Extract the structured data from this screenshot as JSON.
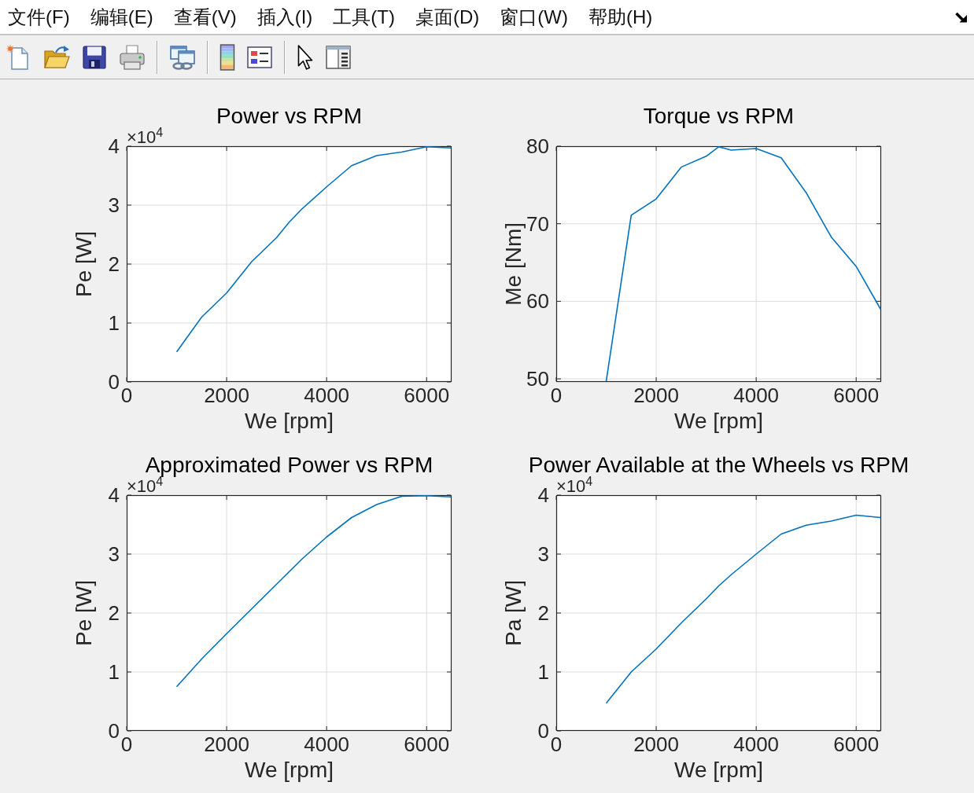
{
  "menu": [
    "文件(F)",
    "编辑(E)",
    "查看(V)",
    "插入(I)",
    "工具(T)",
    "桌面(D)",
    "窗口(W)",
    "帮助(H)"
  ],
  "plots": [
    {
      "exponent": "×10$^{4}$",
      "chart_data": {
        "type": "line",
        "title": "Power vs RPM",
        "xlabel": "We [rpm]",
        "ylabel": "Pe [W]",
        "x": [
          1000,
          1500,
          2000,
          2500,
          3000,
          3250,
          3500,
          4000,
          4500,
          5000,
          5500,
          6000,
          6500
        ],
        "series": [
          {
            "color": "#0072bd",
            "values": [
              0.51,
              1.1,
              1.51,
              2.04,
              2.45,
              2.71,
              2.93,
              3.31,
              3.67,
              3.84,
              3.9,
              4.0,
              3.97
            ]
          }
        ],
        "xlim": [
          0,
          6500
        ],
        "ylim": [
          0,
          4
        ],
        "xticks": [
          0,
          2000,
          4000,
          6000
        ],
        "yticks": [
          0,
          1,
          2,
          3,
          4
        ],
        "grid": true
      }
    },
    {
      "chart_data": {
        "type": "line",
        "title": "Torque vs RPM",
        "xlabel": "We [rpm]",
        "ylabel": "Me [Nm]",
        "x": [
          1000,
          1500,
          2000,
          2500,
          3000,
          3250,
          3500,
          4000,
          4500,
          5000,
          5500,
          6000,
          6500
        ],
        "series": [
          {
            "color": "#0072bd",
            "values": [
              49.6,
              71.1,
              73.2,
              77.3,
              78.7,
              80.0,
              79.5,
              79.7,
              78.5,
              74.0,
              68.3,
              64.5,
              59.0
            ]
          }
        ],
        "xlim": [
          0,
          6500
        ],
        "ylim": [
          49.6,
          80
        ],
        "xticks": [
          0,
          2000,
          4000,
          6000
        ],
        "yticks": [
          50,
          60,
          70,
          80
        ],
        "grid": true
      }
    },
    {
      "exponent": "×10$^{4}$",
      "chart_data": {
        "type": "line",
        "title": "Approximated Power vs RPM",
        "xlabel": "We [rpm]",
        "ylabel": "Pe [W]",
        "x": [
          1000,
          1500,
          2000,
          2500,
          3000,
          3500,
          4000,
          4500,
          5000,
          5500,
          6000,
          6500
        ],
        "series": [
          {
            "color": "#0072bd",
            "values": [
              0.75,
              1.22,
              1.65,
              2.07,
              2.49,
              2.91,
              3.29,
              3.62,
              3.84,
              3.98,
              4.0,
              3.97
            ]
          }
        ],
        "xlim": [
          0,
          6500
        ],
        "ylim": [
          0,
          4
        ],
        "xticks": [
          0,
          2000,
          4000,
          6000
        ],
        "yticks": [
          0,
          1,
          2,
          3,
          4
        ],
        "grid": true
      }
    },
    {
      "exponent": "×10$^{4}$",
      "chart_data": {
        "type": "line",
        "title": "Power Available at the Wheels vs RPM",
        "xlabel": "We [rpm]",
        "ylabel": "Pa [W]",
        "x": [
          1000,
          1500,
          2000,
          2500,
          3000,
          3250,
          3500,
          4000,
          4500,
          5000,
          5500,
          6000,
          6500
        ],
        "series": [
          {
            "color": "#0072bd",
            "values": [
              0.47,
              1.0,
              1.39,
              1.83,
              2.24,
              2.46,
              2.65,
              3.0,
              3.34,
              3.49,
              3.56,
              3.66,
              3.62
            ]
          }
        ],
        "xlim": [
          0,
          6500
        ],
        "ylim": [
          0,
          4
        ],
        "xticks": [
          0,
          2000,
          4000,
          6000
        ],
        "yticks": [
          0,
          1,
          2,
          3,
          4
        ],
        "grid": true
      }
    }
  ]
}
